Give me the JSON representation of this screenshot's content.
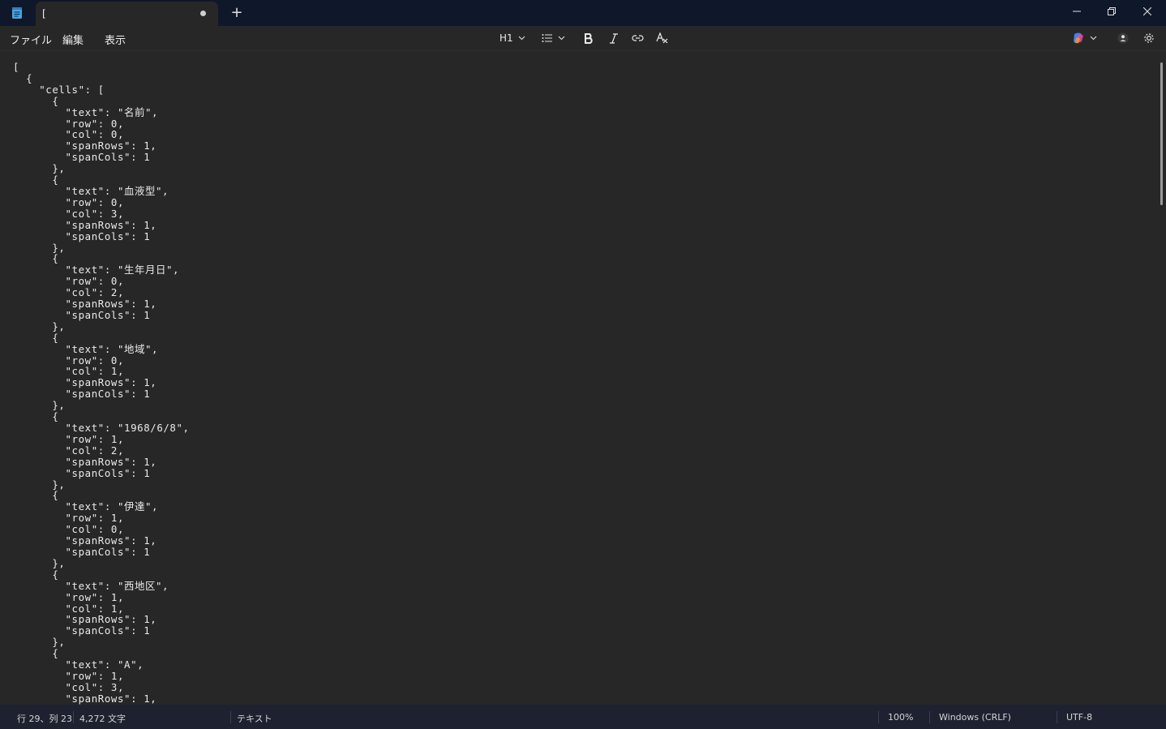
{
  "window": {
    "tab_title": "["
  },
  "menu": {
    "file": "ファイル",
    "edit": "編集",
    "view": "表示"
  },
  "toolbar": {
    "heading": "H1"
  },
  "editor": {
    "content": "[\n  {\n    \"cells\": [\n      {\n        \"text\": \"名前\",\n        \"row\": 0,\n        \"col\": 0,\n        \"spanRows\": 1,\n        \"spanCols\": 1\n      },\n      {\n        \"text\": \"血液型\",\n        \"row\": 0,\n        \"col\": 3,\n        \"spanRows\": 1,\n        \"spanCols\": 1\n      },\n      {\n        \"text\": \"生年月日\",\n        \"row\": 0,\n        \"col\": 2,\n        \"spanRows\": 1,\n        \"spanCols\": 1\n      },\n      {\n        \"text\": \"地域\",\n        \"row\": 0,\n        \"col\": 1,\n        \"spanRows\": 1,\n        \"spanCols\": 1\n      },\n      {\n        \"text\": \"1968/6/8\",\n        \"row\": 1,\n        \"col\": 2,\n        \"spanRows\": 1,\n        \"spanCols\": 1\n      },\n      {\n        \"text\": \"伊達\",\n        \"row\": 1,\n        \"col\": 0,\n        \"spanRows\": 1,\n        \"spanCols\": 1\n      },\n      {\n        \"text\": \"西地区\",\n        \"row\": 1,\n        \"col\": 1,\n        \"spanRows\": 1,\n        \"spanCols\": 1\n      },\n      {\n        \"text\": \"A\",\n        \"row\": 1,\n        \"col\": 3,\n        \"spanRows\": 1,"
  },
  "status": {
    "position": "行 29、列 23",
    "char_count": "4,272 文字",
    "format": "テキスト",
    "zoom": "100%",
    "line_ending": "Windows (CRLF)",
    "encoding": "UTF-8"
  }
}
